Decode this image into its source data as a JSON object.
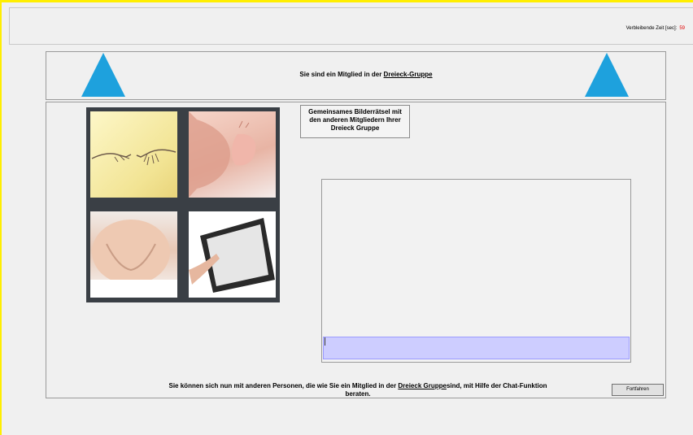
{
  "timer": {
    "label": "Verbleibende Zeit [sec]:",
    "value": "59"
  },
  "group": {
    "text_prefix": "Sie sind ein Mitglied in der",
    "group_name": "Dreieck-Gruppe"
  },
  "caption": {
    "line1": "Gemeinsames Bilderrätsel mit",
    "line2": "den anderen Mitgliedern Ihrer",
    "line3": "Dreieck Gruppe"
  },
  "puzzle": {
    "images": [
      "hands-creation-image",
      "baby-hand-image",
      "pregnant-belly-image",
      "tablet-touch-image"
    ]
  },
  "chat": {
    "input_value": ""
  },
  "footer": {
    "text_before": "Sie können sich nun mit anderen Personen, die wie Sie ein Mitglied in der",
    "group_name": "Dreieck Gruppe",
    "text_after": "sind, mit Hilfe der Chat-Funktion",
    "text_line2": "beraten."
  },
  "next_button": {
    "label": "Fortfahren"
  },
  "colors": {
    "triangle": "#1ea1dd",
    "timer_value": "#e00000",
    "chat_input": "#cdcdff"
  }
}
